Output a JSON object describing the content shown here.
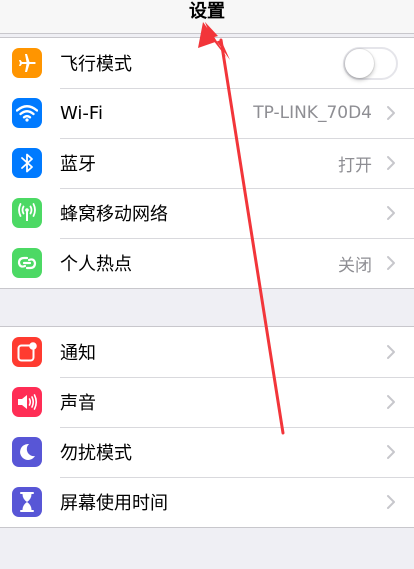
{
  "navbar": {
    "title": "设置"
  },
  "group1": {
    "airplane": {
      "label": "飞行模式",
      "toggle_on": false,
      "icon": "airplane-icon",
      "color": "#ff9500"
    },
    "wifi": {
      "label": "Wi-Fi",
      "value": "TP-LINK_70D4",
      "icon": "wifi-icon",
      "color": "#007aff"
    },
    "bluetooth": {
      "label": "蓝牙",
      "value": "打开",
      "icon": "bluetooth-icon",
      "color": "#007aff"
    },
    "cellular": {
      "label": "蜂窝移动网络",
      "icon": "cellular-antenna-icon",
      "color": "#4cd964"
    },
    "hotspot": {
      "label": "个人热点",
      "value": "关闭",
      "icon": "hotspot-chain-icon",
      "color": "#4cd964"
    }
  },
  "group2": {
    "notifications": {
      "label": "通知",
      "icon": "notifications-icon",
      "color": "#ff3b30"
    },
    "sounds": {
      "label": "声音",
      "icon": "speaker-icon",
      "color": "#ff2d55"
    },
    "dnd": {
      "label": "勿扰模式",
      "icon": "moon-icon",
      "color": "#5856d6"
    },
    "screentime": {
      "label": "屏幕使用时间",
      "icon": "hourglass-icon",
      "color": "#5856d6"
    }
  },
  "annotation": {
    "color": "#f2353a",
    "icon": "red-arrow-annotation"
  }
}
